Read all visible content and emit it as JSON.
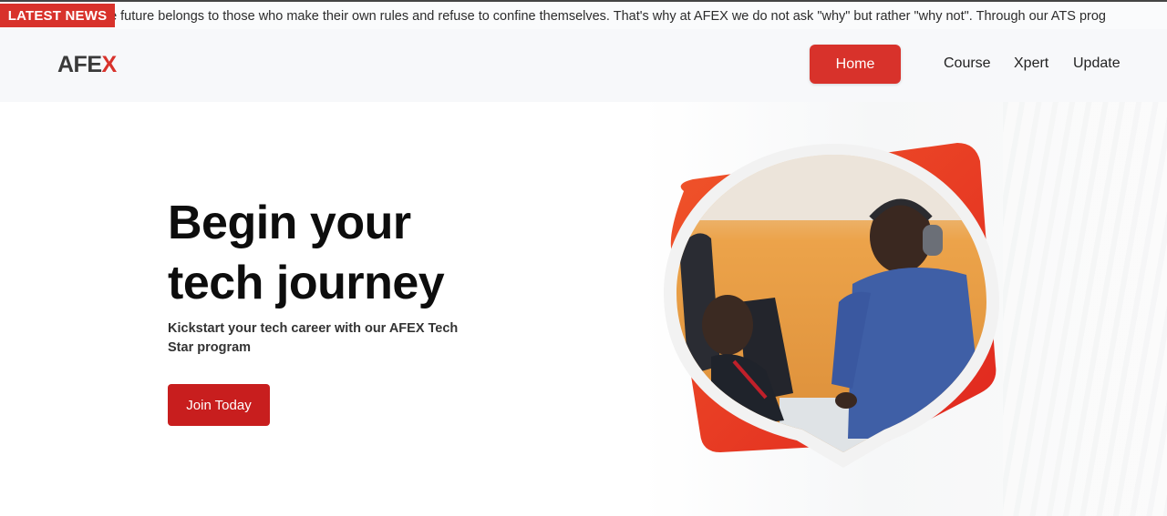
{
  "ticker": {
    "badge": "LATEST NEWS",
    "text": "he future belongs to those who make their own rules and refuse to confine themselves. That's why at AFEX we do not ask \"why\" but rather \"why not\". Through our ATS prog"
  },
  "header": {
    "logo_main": "AFE",
    "logo_accent": "X",
    "nav": {
      "home": "Home",
      "course": "Course",
      "xpert": "Xpert",
      "update": "Update"
    }
  },
  "hero": {
    "title_line1": "Begin your",
    "title_line2": "tech journey",
    "subtitle": "Kickstart your tech career with our AFEX Tech Star program",
    "cta": "Join Today",
    "image_icon": "people-working-photo"
  },
  "colors": {
    "accent": "#d8322b",
    "cta": "#c81e1e",
    "text": "#0d0d0d"
  }
}
